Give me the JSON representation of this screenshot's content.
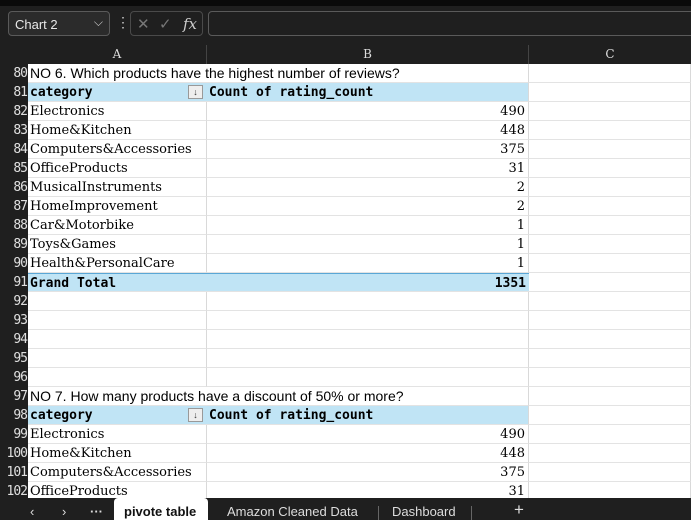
{
  "name_box": "Chart 2",
  "formula": "",
  "columns": [
    "A",
    "B",
    "C"
  ],
  "rows": [
    {
      "n": "80",
      "type": "title",
      "a": "NO 6. Which products have the highest number of reviews?",
      "b": ""
    },
    {
      "n": "81",
      "type": "hdr",
      "a": "category",
      "b": "Count of rating_count"
    },
    {
      "n": "82",
      "type": "data",
      "a": "Electronics",
      "b": "490"
    },
    {
      "n": "83",
      "type": "data",
      "a": "Home&Kitchen",
      "b": "448"
    },
    {
      "n": "84",
      "type": "data",
      "a": "Computers&Accessories",
      "b": "375"
    },
    {
      "n": "85",
      "type": "data",
      "a": "OfficeProducts",
      "b": "31"
    },
    {
      "n": "86",
      "type": "data",
      "a": "MusicalInstruments",
      "b": "2"
    },
    {
      "n": "87",
      "type": "data",
      "a": "HomeImprovement",
      "b": "2"
    },
    {
      "n": "88",
      "type": "data",
      "a": "Car&Motorbike",
      "b": "1"
    },
    {
      "n": "89",
      "type": "data",
      "a": "Toys&Games",
      "b": "1"
    },
    {
      "n": "90",
      "type": "data",
      "a": "Health&PersonalCare",
      "b": "1"
    },
    {
      "n": "91",
      "type": "tot",
      "a": "Grand Total",
      "b": "1351"
    },
    {
      "n": "92",
      "type": "empty",
      "a": "",
      "b": ""
    },
    {
      "n": "93",
      "type": "empty",
      "a": "",
      "b": ""
    },
    {
      "n": "94",
      "type": "empty",
      "a": "",
      "b": ""
    },
    {
      "n": "95",
      "type": "empty",
      "a": "",
      "b": ""
    },
    {
      "n": "96",
      "type": "empty",
      "a": "",
      "b": ""
    },
    {
      "n": "97",
      "type": "title",
      "a": "NO 7. How many products have a discount of 50% or more?",
      "b": ""
    },
    {
      "n": "98",
      "type": "hdr",
      "a": "category",
      "b": "Count of rating_count"
    },
    {
      "n": "99",
      "type": "data",
      "a": "Electronics",
      "b": "490"
    },
    {
      "n": "100",
      "type": "data",
      "a": "Home&Kitchen",
      "b": "448"
    },
    {
      "n": "101",
      "type": "data",
      "a": "Computers&Accessories",
      "b": "375"
    },
    {
      "n": "102",
      "type": "data",
      "a": "OfficeProducts",
      "b": "31"
    }
  ],
  "tabs": {
    "active": "pivote table",
    "others": [
      "Amazon Cleaned Data",
      "Dashboard"
    ],
    "more": "···",
    "add": "+",
    "prev": "‹",
    "next": "›"
  }
}
